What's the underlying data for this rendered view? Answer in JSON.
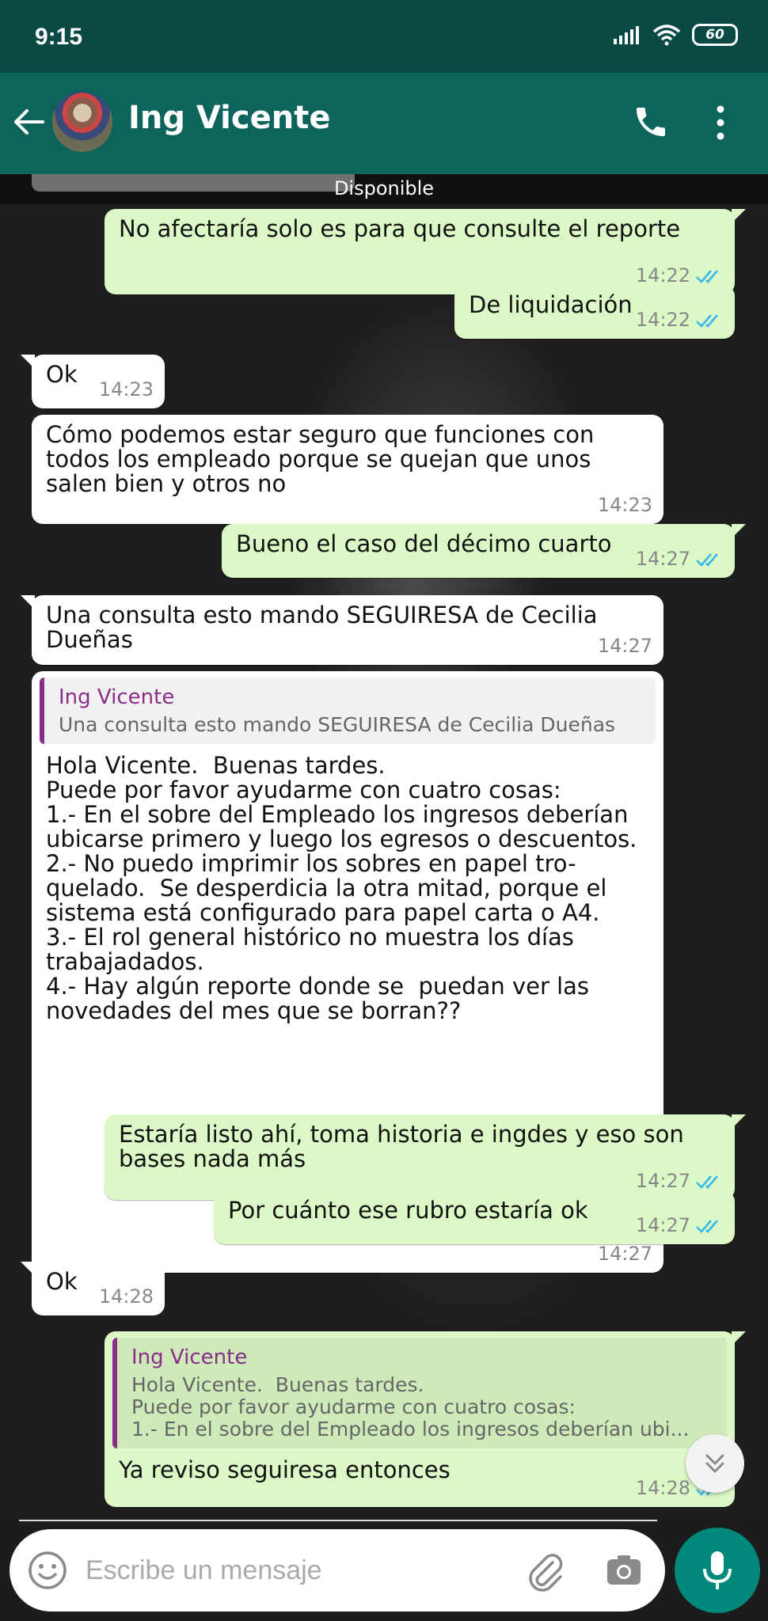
{
  "status_bar": {
    "time": "9:15",
    "battery": "60"
  },
  "header": {
    "contact_name": "Ing Vicente",
    "presence": "Disponible"
  },
  "messages": [
    {
      "dir": "out",
      "text": "No afectaría solo es para que consulte el reporte",
      "time": "14:22"
    },
    {
      "dir": "out",
      "text": "De liquidación",
      "time": "14:22"
    },
    {
      "dir": "in",
      "text": "Ok",
      "time": "14:23"
    },
    {
      "dir": "in",
      "text": "Cómo podemos estar seguro que funciones con todos los empleado porque se quejan que unos salen bien y otros no",
      "time": "14:23"
    },
    {
      "dir": "out",
      "text": "Bueno el caso del décimo cuarto",
      "time": "14:27"
    },
    {
      "dir": "in",
      "text": "Una consulta esto mando SEGUIRESA de Cecilia Dueñas",
      "time": "14:27"
    },
    {
      "dir": "in",
      "quote_name": "Ing Vicente",
      "quote_text": "Una consulta esto mando SEGUIRESA de Cecilia Dueñas",
      "text": "Hola Vicente.  Buenas tardes.\nPuede por favor ayudarme con cuatro cosas:\n1.- En el sobre del Empleado los ingresos deberían ubicarse primero y luego los egresos o descuentos.\n2.- No puedo imprimir los sobres en papel tro-quelado.  Se desperdicia la otra mitad, porque el sistema está configurado para papel carta o A4.\n3.- El rol general histórico no muestra los días trabajadados.\n4.- Hay algún reporte donde se  puedan ver las novedades del mes que se borran??",
      "time": "14:27"
    },
    {
      "dir": "out",
      "text": "Estaría listo ahí, toma historia e ingdes y eso son bases nada más",
      "time": "14:27"
    },
    {
      "dir": "out",
      "text": "Por cuánto ese rubro estaría ok",
      "time": "14:27"
    },
    {
      "dir": "in",
      "text": "Ok",
      "time": "14:28"
    },
    {
      "dir": "out",
      "quote_name": "Ing Vicente",
      "quote_text": "Hola Vicente.  Buenas tardes.\nPuede por favor ayudarme con cuatro cosas:\n1.- En el sobre del Empleado los ingresos deberían ubi...",
      "text": "Ya reviso seguiresa entonces",
      "time": "14:28"
    }
  ],
  "composer": {
    "placeholder": "Escribe un mensaje"
  },
  "colors": {
    "header": "#0c645a",
    "status_bar": "#0b4a44",
    "outgoing_bubble": "#dcf8c6",
    "incoming_bubble": "#ffffff",
    "quote_accent": "#8a2d8a",
    "read_ticks": "#34b7f1",
    "mic_button": "#00897b"
  },
  "icons": [
    "back-arrow-icon",
    "phone-icon",
    "more-vert-icon",
    "emoji-icon",
    "paperclip-icon",
    "camera-icon",
    "mic-icon",
    "double-check-icon",
    "chevrons-down-icon"
  ]
}
